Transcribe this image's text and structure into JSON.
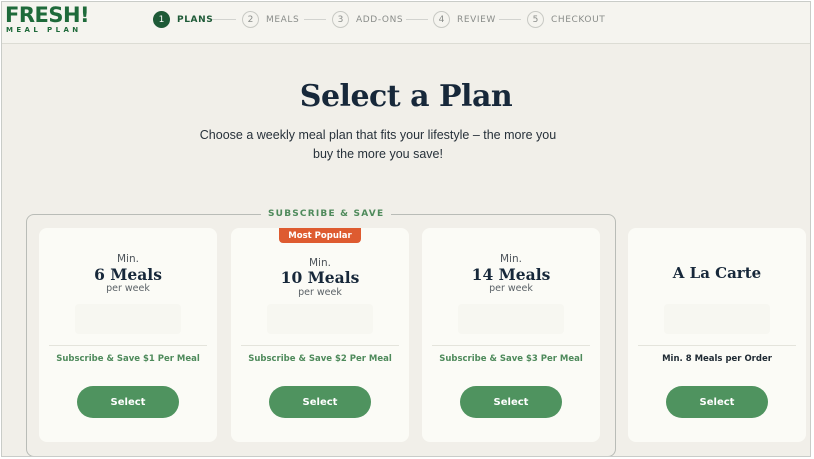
{
  "logo": {
    "main": "FRESH!",
    "sub": "MEAL PLAN"
  },
  "steps": [
    {
      "num": "1",
      "label": "PLANS",
      "active": true
    },
    {
      "num": "2",
      "label": "MEALS",
      "active": false
    },
    {
      "num": "3",
      "label": "ADD-ONS",
      "active": false
    },
    {
      "num": "4",
      "label": "REVIEW",
      "active": false
    },
    {
      "num": "5",
      "label": "CHECKOUT",
      "active": false
    }
  ],
  "page": {
    "title": "Select a Plan",
    "subtitle": "Choose a weekly meal plan that fits your lifestyle – the more you buy the more you save!"
  },
  "group_label": "SUBSCRIBE & SAVE",
  "plans": [
    {
      "min": "Min.",
      "meals": "6 Meals",
      "per": "per week",
      "save": "Subscribe & Save $1 Per Meal",
      "button": "Select"
    },
    {
      "badge": "Most Popular",
      "min": "Min.",
      "meals": "10 Meals",
      "per": "per week",
      "save": "Subscribe & Save $2 Per Meal",
      "button": "Select"
    },
    {
      "min": "Min.",
      "meals": "14 Meals",
      "per": "per week",
      "save": "Subscribe & Save $3 Per Meal",
      "button": "Select"
    }
  ],
  "a_la_carte": {
    "title": "A La Carte",
    "note": "Min. 8 Meals per Order",
    "button": "Select"
  },
  "colors": {
    "brand_green": "#1e6a3a",
    "button_green": "#4f935f",
    "badge_orange": "#de5b30",
    "background": "#f1efe9"
  }
}
